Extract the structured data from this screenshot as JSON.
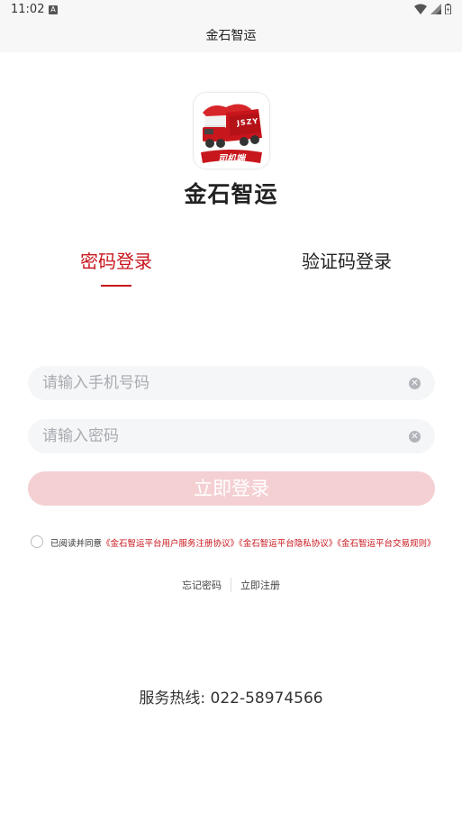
{
  "status_bar": {
    "time": "11:02",
    "notification_badge": "A"
  },
  "header": {
    "title": "金石智运"
  },
  "brand": {
    "name": "金石智运",
    "logo_badge": "司机端",
    "logo_truck_text": "JSZY"
  },
  "tabs": [
    {
      "label": "密码登录",
      "active": true
    },
    {
      "label": "验证码登录",
      "active": false
    }
  ],
  "form": {
    "phone": {
      "placeholder": "请输入手机号码",
      "value": ""
    },
    "password": {
      "placeholder": "请输入密码",
      "value": ""
    },
    "submit_label": "立即登录"
  },
  "agreement": {
    "prefix": "已阅读并同意",
    "links": [
      "《金石智运平台用户服务注册协议》",
      "《金石智运平台隐私协议》",
      "《金石智运平台交易规则》"
    ],
    "checked": false
  },
  "links": {
    "forgot_password": "忘记密码",
    "register": "立即注册"
  },
  "hotline": "服务热线: 022-58974566",
  "colors": {
    "accent": "#c8161d",
    "button_disabled": "#f4d0d2",
    "field_bg": "#f5f6f8"
  },
  "icons": [
    "wifi-icon",
    "signal-icon",
    "battery-icon",
    "clear-icon"
  ]
}
